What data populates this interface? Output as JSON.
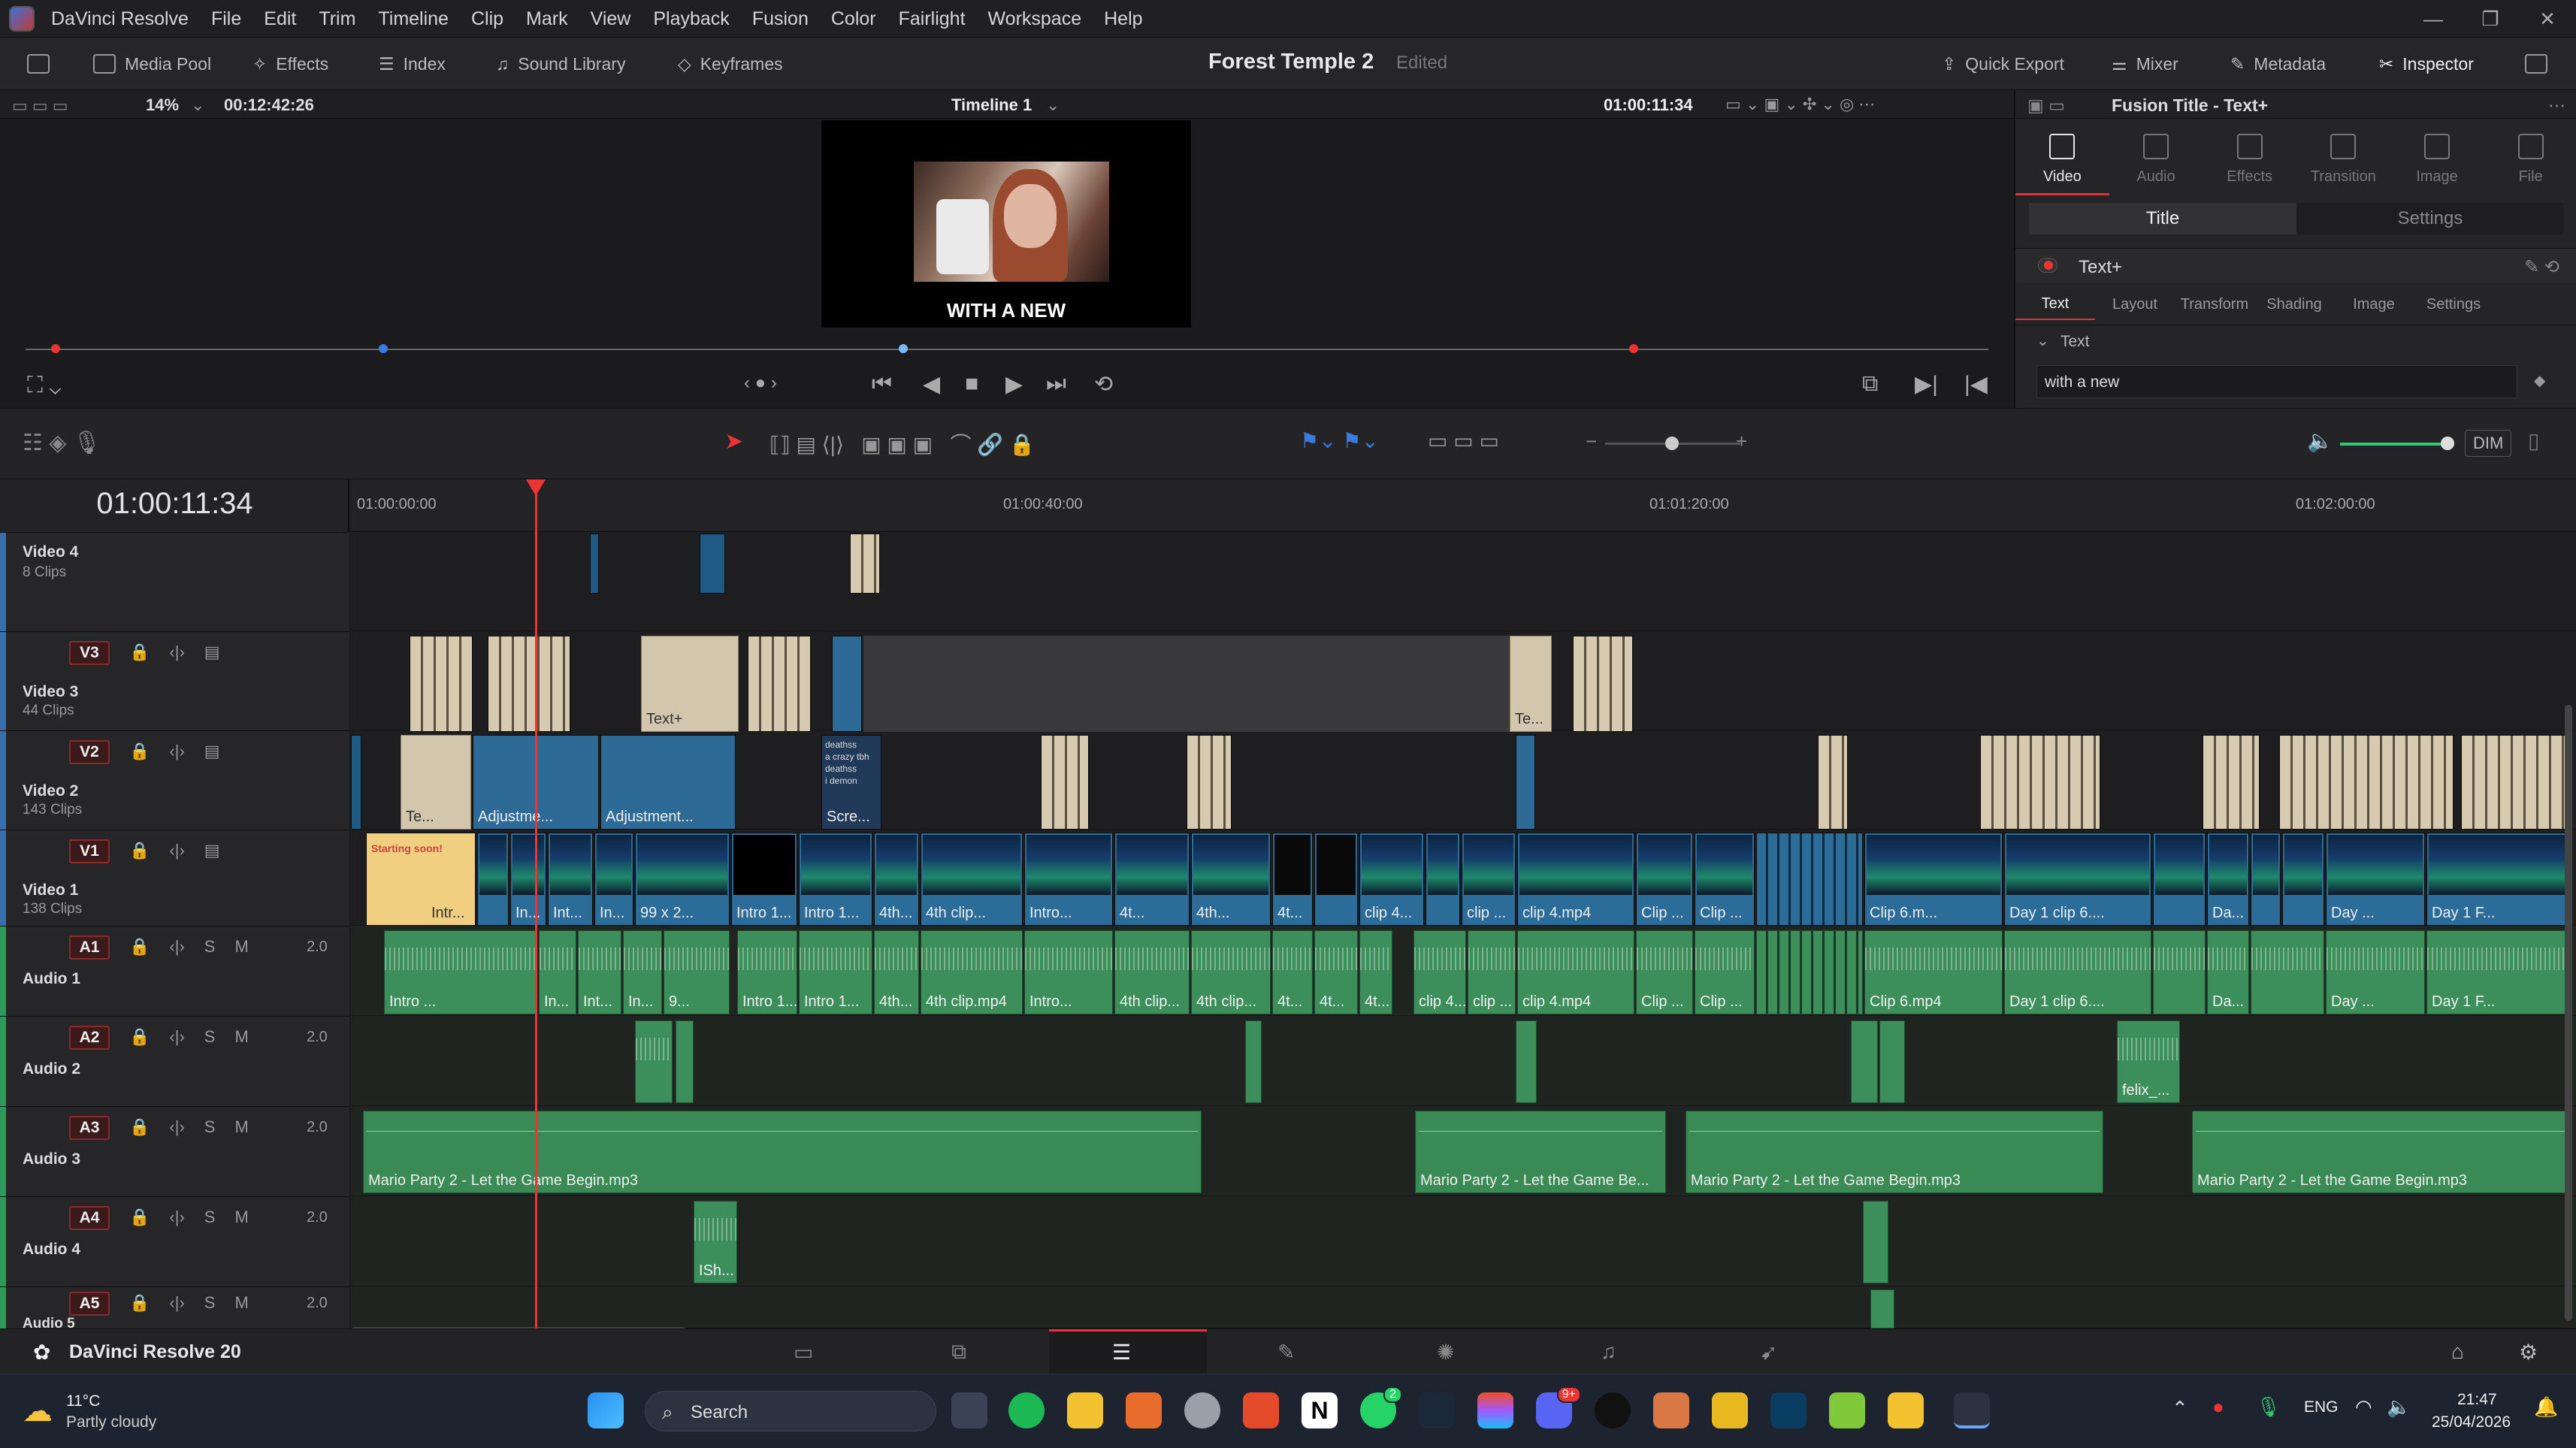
{
  "menubar": {
    "app_name": "DaVinci Resolve",
    "items": [
      "File",
      "Edit",
      "Trim",
      "Timeline",
      "Clip",
      "Mark",
      "View",
      "Playback",
      "Fusion",
      "Color",
      "Fairlight",
      "Workspace",
      "Help"
    ]
  },
  "toolbar": {
    "media_pool": "Media Pool",
    "effects": "Effects",
    "index": "Index",
    "sound_library": "Sound Library",
    "keyframes": "Keyframes",
    "project_title": "Forest Temple 2",
    "project_status": "Edited",
    "quick_export": "Quick Export",
    "mixer": "Mixer",
    "metadata": "Metadata",
    "inspector": "Inspector"
  },
  "viewer": {
    "zoom": "14%",
    "duration": "00:12:42:26",
    "timeline_name": "Timeline 1",
    "current_timecode": "01:00:11:34",
    "caption": "WITH A NEW"
  },
  "inspector": {
    "title": "Fusion Title - Text+",
    "tabs": [
      "Video",
      "Audio",
      "Effects",
      "Transition",
      "Image",
      "File"
    ],
    "segments": [
      "Title",
      "Settings"
    ],
    "node_name": "Text+",
    "subtabs": [
      "Text",
      "Layout",
      "Transform",
      "Shading",
      "Image",
      "Settings"
    ],
    "section": "Text",
    "text_value": "with a new"
  },
  "timeline": {
    "timecode": "01:00:11:34",
    "ruler": [
      "01:00:00:00",
      "01:00:40:00",
      "01:01:20:00",
      "01:02:00:00"
    ],
    "volume_button": "DIM",
    "video_tracks": [
      {
        "id": "V4",
        "name": "Video 4",
        "clips": "8 Clips"
      },
      {
        "id": "V3",
        "name": "Video 3",
        "clips": "44 Clips"
      },
      {
        "id": "V2",
        "name": "Video 2",
        "clips": "143 Clips"
      },
      {
        "id": "V1",
        "name": "Video 1",
        "clips": "138 Clips"
      }
    ],
    "audio_tracks": [
      {
        "id": "A1",
        "name": "Audio 1",
        "vol": "2.0"
      },
      {
        "id": "A2",
        "name": "Audio 2",
        "vol": "2.0"
      },
      {
        "id": "A3",
        "name": "Audio 3",
        "vol": "2.0"
      },
      {
        "id": "A4",
        "name": "Audio 4",
        "vol": "2.0"
      },
      {
        "id": "A5",
        "name": "Audio 5",
        "vol": "2.0"
      }
    ],
    "v3_labels": [
      "Text+",
      "Te..."
    ],
    "v2_labels": [
      "Te...",
      "Adjustme...",
      "Adjustment...",
      "Scre..."
    ],
    "v1_labels": [
      "Intr...",
      "In...",
      "Int...",
      "In...",
      "99 x 2...",
      "Intro 1...",
      "Intro 1...",
      "4th...",
      "4th clip...",
      "Intro...",
      "4t...",
      "4th...",
      "4t...",
      "clip 4...",
      "clip ...",
      "clip 4.mp4",
      "Clip ...",
      "Clip ...",
      "Clip 6.m...",
      "Day 1 clip 6....",
      "Da...",
      "Day ...",
      "Day 1 F..."
    ],
    "a1_labels": [
      "Intro ...",
      "In...",
      "Int...",
      "In...",
      "9...",
      "Intro 1...",
      "Intro 1...",
      "4th...",
      "4th clip.mp4",
      "Intro...",
      "4th clip...",
      "4th clip...",
      "4t...",
      "4t...",
      "4t...",
      "clip 4...",
      "clip ...",
      "clip 4.mp4",
      "Clip ...",
      "Clip ...",
      "Clip 6.mp4",
      "Day 1 clip 6....",
      "Da...",
      "Day ...",
      "Day 1 F..."
    ],
    "a2_labels": [
      "felix_..."
    ],
    "a3_labels": [
      "Mario Party 2 - Let the Game Begin.mp3",
      "Mario Party 2 - Let the Game Be...",
      "Mario Party 2 - Let the Game Begin.mp3",
      "Mario Party 2 - Let the Game Begin.mp3"
    ],
    "a4_labels": [
      "ISh..."
    ],
    "v2_scre_lines": [
      "deathss",
      "a crazy tbh",
      "deathss",
      "i demon"
    ],
    "v1_first_clip": "Starting soon!"
  },
  "pagebar": {
    "app_version": "DaVinci Resolve 20"
  },
  "taskbar": {
    "temp": "11°C",
    "weather": "Partly cloudy",
    "search": "Search",
    "lang": "ENG",
    "time": "21:47",
    "date": "25/04/2026",
    "badge_whatsapp": "2",
    "badge_discord": "9+"
  },
  "colors": {
    "accent_red": "#e33333",
    "audio_green": "#3c8f5a",
    "video_blue": "#2b6c98",
    "title_tan": "#d2c6ac"
  }
}
